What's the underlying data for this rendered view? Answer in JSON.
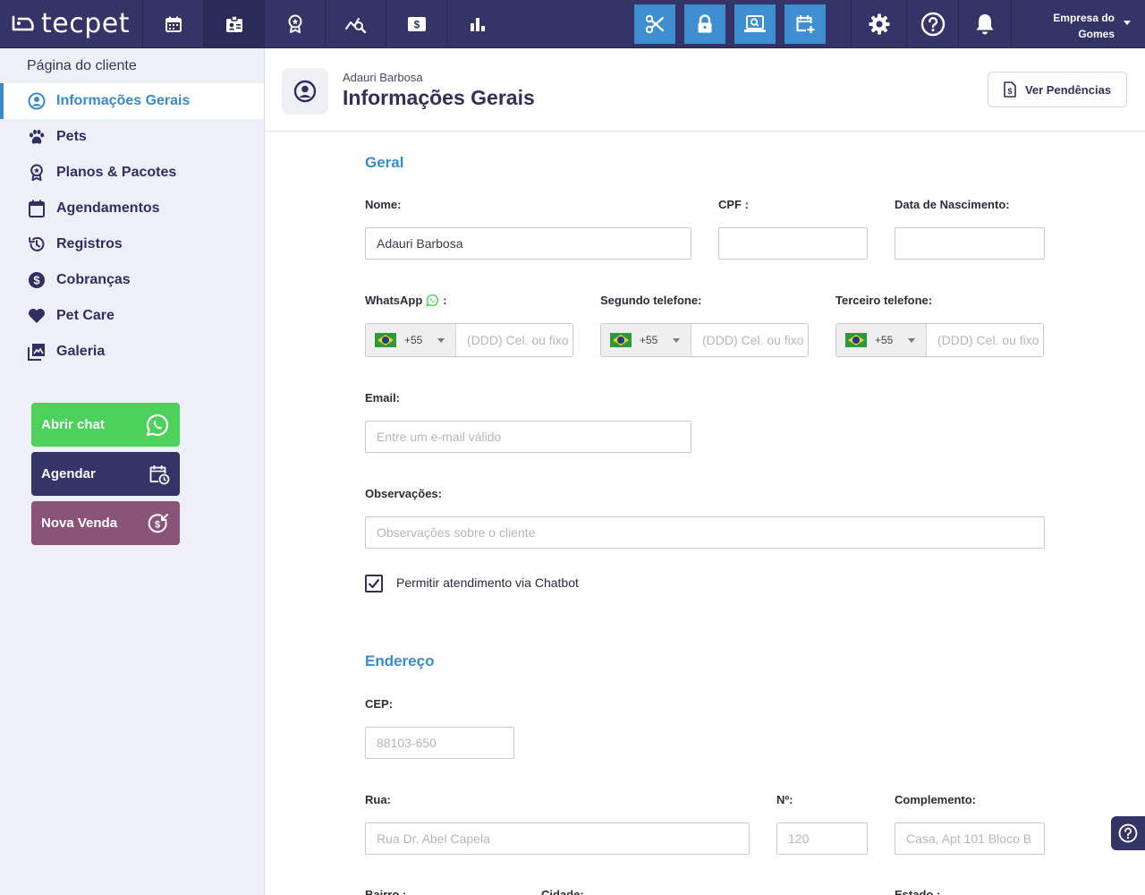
{
  "app": {
    "logo_text": "tecpet",
    "company_line1": "Empresa do",
    "company_line2": "Gomes"
  },
  "topbar": {
    "icons": [
      "calendar-icon",
      "client-card-icon",
      "award-icon",
      "analytics-icon",
      "money-icon",
      "bar-chart-icon",
      "scissors-icon",
      "lock-icon",
      "cashier-icon",
      "calendar-add-icon",
      "gear-icon",
      "help-icon",
      "bell-icon"
    ]
  },
  "sidebar": {
    "title": "Página do cliente",
    "items": [
      {
        "label": "Informações Gerais",
        "icon": "user-circle-icon"
      },
      {
        "label": "Pets",
        "icon": "paw-icon"
      },
      {
        "label": "Planos & Pacotes",
        "icon": "award-icon"
      },
      {
        "label": "Agendamentos",
        "icon": "calendar-icon"
      },
      {
        "label": "Registros",
        "icon": "history-icon"
      },
      {
        "label": "Cobranças",
        "icon": "dollar-icon"
      },
      {
        "label": "Pet Care",
        "icon": "heart-icon"
      },
      {
        "label": "Galeria",
        "icon": "gallery-icon"
      }
    ],
    "actions": [
      {
        "label": "Abrir chat",
        "color": "#4cd15a"
      },
      {
        "label": "Agendar",
        "color": "#343466"
      },
      {
        "label": "Nova Venda",
        "color": "#8a5478"
      }
    ]
  },
  "header": {
    "subtitle": "Adauri Barbosa",
    "title": "Informações Gerais",
    "pending_button": "Ver Pendências"
  },
  "general": {
    "section_title": "Geral",
    "name_label": "Nome:",
    "name_value": "Adauri Barbosa",
    "cpf_label": "CPF :",
    "cpf_value": "",
    "birth_label": "Data de Nascimento:",
    "birth_value": "",
    "whatsapp_label": "WhatsApp",
    "whatsapp_colon": ":",
    "phone2_label": "Segundo telefone:",
    "phone3_label": "Terceiro telefone:",
    "country_code": "+55",
    "phone_placeholder": "(DDD) Cel. ou fixo",
    "email_label": "Email:",
    "email_placeholder": "Entre um e-mail válido",
    "notes_label": "Observações:",
    "notes_placeholder": "Observações sobre o cliente",
    "chatbot_label": "Permitir atendimento via Chatbot",
    "chatbot_checked": true
  },
  "address": {
    "section_title": "Endereço",
    "cep_label": "CEP:",
    "cep_placeholder": "88103-650",
    "street_label": "Rua:",
    "street_placeholder": "Rua Dr. Abel Capela",
    "number_label": "Nº:",
    "number_placeholder": "120",
    "complement_label": "Complemento:",
    "complement_placeholder": "Casa, Apt 101 Bloco B",
    "district_label": "Bairro :",
    "city_label": "Cidade:",
    "state_label": "Estado :"
  },
  "colors": {
    "navy": "#343466",
    "accent_blue": "#3a8ac9",
    "whatsapp_green": "#4cd15a",
    "sale_purple": "#8a5478"
  }
}
